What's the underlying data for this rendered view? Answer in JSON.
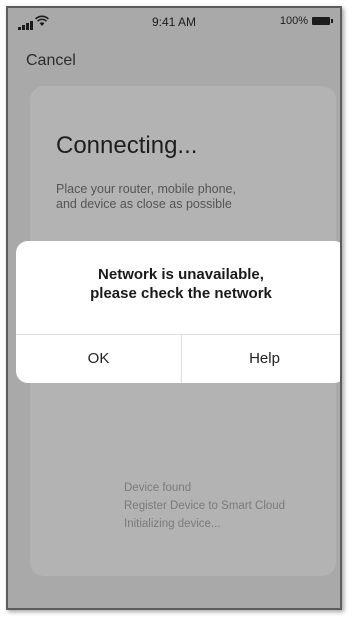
{
  "status_bar": {
    "time": "9:41 AM",
    "battery": "100%",
    "icons": [
      "signal-icon",
      "wifi-icon",
      "battery-icon"
    ]
  },
  "nav": {
    "cancel_label": "Cancel"
  },
  "card": {
    "title": "Connecting...",
    "subtitle": "Place your router, mobile phone,\nand device as close as possible",
    "steps": [
      "Device found",
      "Register Device to Smart Cloud",
      "Initializing device..."
    ]
  },
  "dialog": {
    "message": "Network is unavailable,\nplease check the network",
    "ok_label": "OK",
    "help_label": "Help"
  },
  "colors": {
    "overlay": "#a9a9a9",
    "card": "#b3b3b3",
    "dialog": "#ffffff",
    "ring_accent": "#6f8f8f"
  }
}
